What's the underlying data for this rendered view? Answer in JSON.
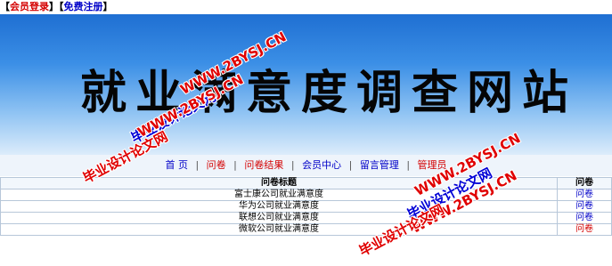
{
  "topbar": {
    "login": "会员登录",
    "register": "免费注册",
    "lb": "【",
    "rb": "】"
  },
  "banner": {
    "title": "就业满意度调查网站"
  },
  "nav": {
    "items": [
      "首 页",
      "问卷",
      "问卷结果",
      "会员中心",
      "留言管理",
      "管理员"
    ],
    "sep": "|"
  },
  "table": {
    "headers": [
      "问卷标题",
      "问卷"
    ],
    "rows": [
      {
        "title": "富士康公司就业满意度",
        "link": "问卷"
      },
      {
        "title": "华为公司就业满意度",
        "link": "问卷"
      },
      {
        "title": "联想公司就业满意度",
        "link": "问卷"
      },
      {
        "title": "微软公司就业满意度",
        "link": "问卷"
      }
    ]
  },
  "watermarks": {
    "url": "WWW.2BYSJ.CN",
    "name": "毕业设计论文网"
  },
  "colors": {
    "link_blue": "#0000c8",
    "link_red": "#d40000",
    "banner_top": "#1f6fd2",
    "banner_bottom": "#dcecfb"
  }
}
